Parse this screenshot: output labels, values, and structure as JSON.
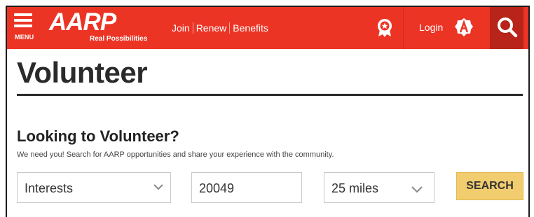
{
  "header": {
    "menu_label": "MENU",
    "logo_text": "AARP",
    "logo_tagline": "Real Possibilities",
    "nav": [
      "Join",
      "Renew",
      "Benefits"
    ],
    "login_label": "Login",
    "brand_color": "#ec3425"
  },
  "page": {
    "title": "Volunteer",
    "section_heading": "Looking to Volunteer?",
    "section_description": "We need you! Search for AARP opportunities and share your experience with the community."
  },
  "search_form": {
    "interests_value": "Interests",
    "zip_value": "20049",
    "distance_value": "25 miles",
    "search_label": "SEARCH"
  },
  "icons": [
    "menu-icon",
    "rewards-badge-icon",
    "login-avatar-icon",
    "search-icon",
    "chevron-down-icon"
  ]
}
